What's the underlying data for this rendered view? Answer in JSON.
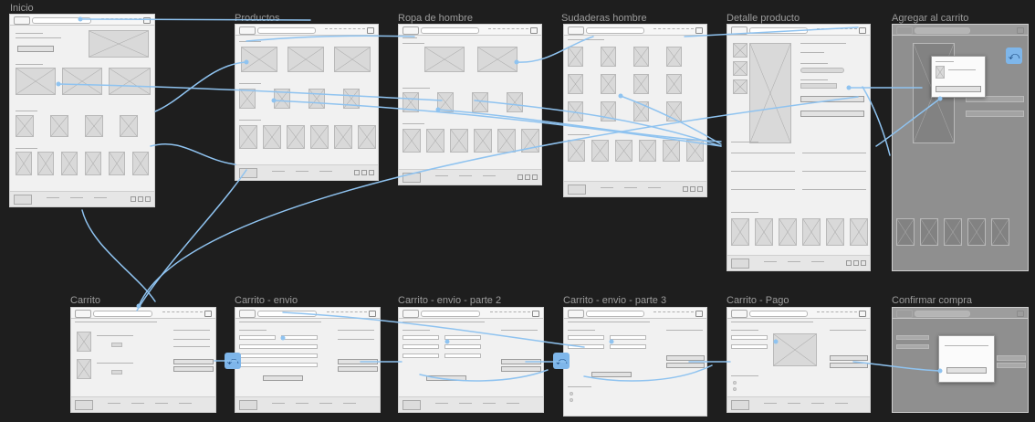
{
  "frames": [
    {
      "id": "inicio",
      "title": "Inicio"
    },
    {
      "id": "productos",
      "title": "Productos"
    },
    {
      "id": "ropa-hombre",
      "title": "Ropa de hombre"
    },
    {
      "id": "sudaderas",
      "title": "Sudaderas hombre"
    },
    {
      "id": "detalle",
      "title": "Detalle producto"
    },
    {
      "id": "agregar",
      "title": "Agregar al carrito"
    },
    {
      "id": "carrito",
      "title": "Carrito"
    },
    {
      "id": "envio",
      "title": "Carrito - envio"
    },
    {
      "id": "envio2",
      "title": "Carrito - envio - parte 2"
    },
    {
      "id": "envio3",
      "title": "Carrito - envio - parte 3"
    },
    {
      "id": "pago",
      "title": "Carrito - Pago"
    },
    {
      "id": "confirmar",
      "title": "Confirmar compra"
    }
  ],
  "back_icon": "back-arrow-icon",
  "colors": {
    "canvas": "#1e1e1e",
    "frame": "#f1f1f1",
    "connector": "#8fc3f0",
    "back_badge": "#7eb6ea"
  }
}
